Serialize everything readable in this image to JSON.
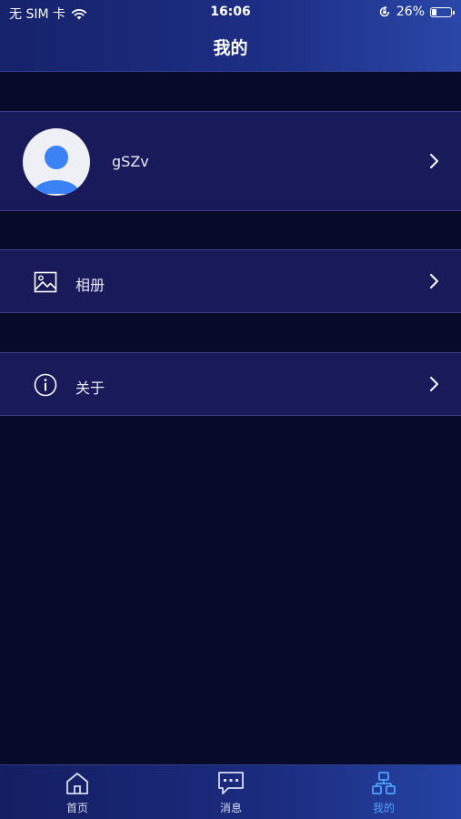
{
  "status_bar": {
    "carrier": "无 SIM 卡",
    "time": "16:06",
    "battery_percent": "26%",
    "battery_level": 0.26,
    "icons": [
      "wifi-icon",
      "orientation-lock-icon",
      "battery-icon"
    ]
  },
  "header": {
    "title": "我的"
  },
  "profile": {
    "username": "gSZv",
    "avatar_icon": "person-icon"
  },
  "menu": {
    "album": {
      "label": "相册",
      "icon": "image-icon"
    },
    "about": {
      "label": "关于",
      "icon": "info-icon"
    }
  },
  "tabbar": {
    "items": [
      {
        "label": "首页",
        "icon": "home-icon",
        "active": false
      },
      {
        "label": "消息",
        "icon": "message-icon",
        "active": false
      },
      {
        "label": "我的",
        "icon": "user-org-icon",
        "active": true
      }
    ]
  },
  "colors": {
    "background": "#080a2a",
    "row": "#191a5a",
    "header": "#1d2f86",
    "active_tab": "#4fa0ff",
    "avatar": "#3b82f6"
  }
}
